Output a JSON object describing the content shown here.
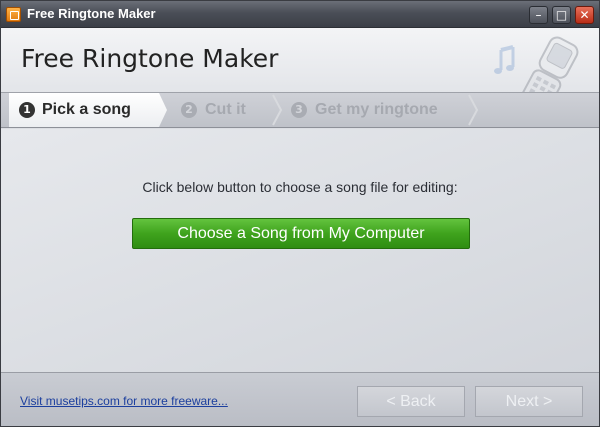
{
  "window": {
    "title": "Free Ringtone Maker",
    "controls": {
      "minimize": "–",
      "maximize": "□",
      "close": "✕"
    }
  },
  "header": {
    "app_name": "Free Ringtone Maker",
    "art_icons": [
      "music-note-icon",
      "phone-icon"
    ]
  },
  "steps": [
    {
      "number": "1",
      "label": "Pick a song",
      "active": true
    },
    {
      "number": "2",
      "label": "Cut it",
      "active": false
    },
    {
      "number": "3",
      "label": "Get my ringtone",
      "active": false
    }
  ],
  "main": {
    "instruction": "Click below button to choose a song file for editing:",
    "choose_button": "Choose a Song from My Computer"
  },
  "footer": {
    "link_text": "Visit musetips.com for more freeware...",
    "back_button": "< Back",
    "next_button": "Next >"
  },
  "colors": {
    "accent_green": "#3fa31d",
    "link_blue": "#1c3f9e",
    "titlebar": "#4a4e57",
    "close_red": "#b82d17"
  }
}
